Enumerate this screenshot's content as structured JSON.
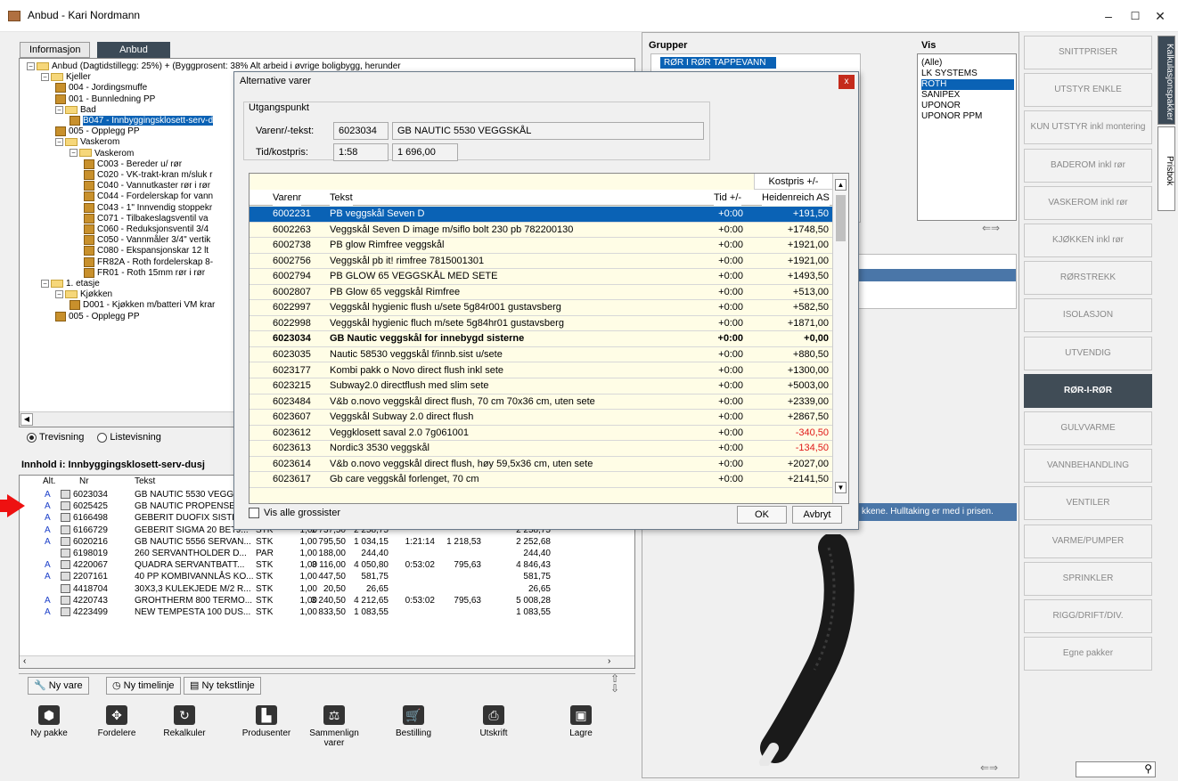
{
  "window": {
    "title": "Anbud - Kari Nordmann",
    "minimize": "–",
    "maximize": "☐",
    "close": "✕"
  },
  "tabs": [
    "Informasjon",
    "Anbud"
  ],
  "tree": [
    {
      "text": "Anbud (Dagtidstillegg: 25%) + (Byggprosent: 38%   Alt arbeid i øvrige boligbygg, herunder",
      "level": 0,
      "type": "folder"
    },
    {
      "text": "Kjeller",
      "level": 1,
      "type": "folder"
    },
    {
      "text": "004 - Jordingsmuffe",
      "level": 2,
      "type": "pkg"
    },
    {
      "text": "001 - Bunnledning PP",
      "level": 2,
      "type": "pkg"
    },
    {
      "text": "Bad",
      "level": 2,
      "type": "folder"
    },
    {
      "text": "B047 - Innbyggingsklosett-serv-d",
      "level": 3,
      "type": "pkg",
      "selected": true
    },
    {
      "text": "005 - Opplegg PP",
      "level": 2,
      "type": "pkg"
    },
    {
      "text": "Vaskerom",
      "level": 2,
      "type": "folder"
    },
    {
      "text": "Vaskerom",
      "level": 3,
      "type": "folder"
    },
    {
      "text": "C003 - Bereder u/ rør",
      "level": 4,
      "type": "pkg"
    },
    {
      "text": "C020 - VK-trakt-kran m/sluk r",
      "level": 4,
      "type": "pkg"
    },
    {
      "text": "C040 - Vannutkaster rør i rør",
      "level": 4,
      "type": "pkg"
    },
    {
      "text": "C044 - Fordelerskap for vann",
      "level": 4,
      "type": "pkg"
    },
    {
      "text": "C043 - 1\" Innvendig stoppekr",
      "level": 4,
      "type": "pkg"
    },
    {
      "text": "C071 - Tilbakeslagsventil va",
      "level": 4,
      "type": "pkg"
    },
    {
      "text": "C060 - Reduksjonsventil  3/4",
      "level": 4,
      "type": "pkg"
    },
    {
      "text": "C050 - Vannmåler 3/4\" vertik",
      "level": 4,
      "type": "pkg"
    },
    {
      "text": "C080 - Ekspansjonskar  12 lt",
      "level": 4,
      "type": "pkg"
    },
    {
      "text": "FR82A - Roth fordelerskap 8-",
      "level": 4,
      "type": "pkg"
    },
    {
      "text": "FR01 - Roth 15mm rør i rør",
      "level": 4,
      "type": "pkg"
    },
    {
      "text": "1. etasje",
      "level": 1,
      "type": "folder"
    },
    {
      "text": "Kjøkken",
      "level": 2,
      "type": "folder"
    },
    {
      "text": "D001 - Kjøkken m/batteri VM krar",
      "level": 3,
      "type": "pkg"
    },
    {
      "text": "005 - Opplegg PP",
      "level": 2,
      "type": "pkg"
    }
  ],
  "view": {
    "tree": "Trevisning",
    "list": "Listevisning"
  },
  "content_title": "Innhold i: Innbyggingsklosett-serv-dusj",
  "grid": {
    "headers": [
      "Alt.",
      "Nr",
      "Tekst"
    ],
    "rows": [
      [
        "A",
        "6023034",
        "GB NAUTIC 5530 VEGGS",
        "",
        "",
        "",
        "",
        "",
        "",
        ""
      ],
      [
        "A",
        "6025425",
        "GB NAUTIC PROPENSET",
        "",
        "",
        "",
        "",
        "",
        "",
        ""
      ],
      [
        "A",
        "6166498",
        "GEBERIT DUOFIX SISTE",
        "",
        "",
        "",
        "",
        "",
        "",
        ""
      ],
      [
        "A",
        "6166729",
        "GEBERIT SIGMA 20 BETJ...",
        "STK",
        "1,00",
        "1 737,50",
        "2 258,75",
        "",
        "",
        "2 258,75"
      ],
      [
        "A",
        "6020216",
        "GB NAUTIC 5556 SERVAN...",
        "STK",
        "1,00",
        "795,50",
        "1 034,15",
        "1:21:14",
        "1 218,53",
        "2 252,68"
      ],
      [
        "",
        "6198019",
        "260 SERVANTHOLDER D...",
        "PAR",
        "1,00",
        "188,00",
        "244,40",
        "",
        "",
        "244,40"
      ],
      [
        "A",
        "4220067",
        "QUADRA SERVANTBATT...",
        "STK",
        "1,00",
        "3 116,00",
        "4 050,80",
        "0:53:02",
        "795,63",
        "4 846,43"
      ],
      [
        "A",
        "2207161",
        "40 PP KOMBIVANNLÅS KO...",
        "STK",
        "1,00",
        "447,50",
        "581,75",
        "",
        "",
        "581,75"
      ],
      [
        "",
        "4418704",
        "30X3,3 KULEKJEDE M/2 R...",
        "STK",
        "1,00",
        "20,50",
        "26,65",
        "",
        "",
        "26,65"
      ],
      [
        "A",
        "4220743",
        "GROHTHERM 800 TERMO...",
        "STK",
        "1,00",
        "3 240,50",
        "4 212,65",
        "0:53:02",
        "795,63",
        "5 008,28"
      ],
      [
        "A",
        "4223499",
        "NEW TEMPESTA 100 DUS...",
        "STK",
        "1,00",
        "833,50",
        "1 083,55",
        "",
        "",
        "1 083,55"
      ]
    ]
  },
  "bottom_buttons": {
    "ny_vare": "Ny vare",
    "ny_timelinje": "Ny timelinje",
    "ny_tekstlinje": "Ny tekstlinje"
  },
  "toolbar": [
    {
      "label": "Ny pakke",
      "icon": "package-icon"
    },
    {
      "label": "Fordelere",
      "icon": "distributor-icon"
    },
    {
      "label": "Rekalkuler",
      "icon": "recalculate-icon"
    },
    {
      "label": "Produsenter",
      "icon": "factory-icon"
    },
    {
      "label": "Sammenlign varer",
      "icon": "scale-icon"
    },
    {
      "label": "Bestilling",
      "icon": "cart-icon"
    },
    {
      "label": "Utskrift",
      "icon": "printer-icon"
    },
    {
      "label": "Lagre",
      "icon": "save-icon"
    }
  ],
  "groups": {
    "label": "Grupper",
    "selected": "RØR I RØR TAPPEVANN"
  },
  "vis": {
    "label": "Vis",
    "items": [
      "(Alle)",
      "LK SYSTEMS",
      "ROTH",
      "SANIPEX",
      "UPONOR",
      "UPONOR PPM"
    ],
    "selected": "ROTH"
  },
  "categories": [
    "SNITTPRISER",
    "UTSTYR  ENKLE",
    "KUN UTSTYR inkl montering",
    "BADEROM inkl rør",
    "VASKEROM inkl rør",
    "KJØKKEN inkl rør",
    "RØRSTREKK",
    "ISOLASJON",
    "UTVENDIG",
    "RØR-I-RØR",
    "GULVVARME",
    "VANNBEHANDLING",
    "VENTILER",
    "VARME/PUMPER",
    "SPRINKLER",
    "RIGG/DRIFT/DIV.",
    "Egne pakker"
  ],
  "active_category": "RØR-I-RØR",
  "vertical_tabs": [
    "Kalkulasjonspakker",
    "Prisbok"
  ],
  "info_strip": "kkene. Hulltaking er med i prisen.",
  "dialog": {
    "title": "Alternative varer",
    "close": "x",
    "legend": "Utgangspunkt",
    "varenr_label": "Varenr/-tekst:",
    "varenr": "6023034",
    "vare_tekst": "GB NAUTIC 5530 VEGGSKÅL",
    "tid_label": "Tid/kostpris:",
    "tid": "1:58",
    "kostpris": "1 696,00",
    "col_group": "Kostpris +/-",
    "headers": [
      "Varenr",
      "Tekst",
      "Tid +/-",
      "Heidenreich AS"
    ],
    "rows": [
      {
        "nr": "6002231",
        "tekst": "PB veggskål Seven D",
        "tid": "+0:00",
        "pris": "+191,50",
        "selected": true
      },
      {
        "nr": "6002263",
        "tekst": "Veggskål Seven D image m/siflo bolt 230 pb 782200130",
        "tid": "+0:00",
        "pris": "+1748,50"
      },
      {
        "nr": "6002738",
        "tekst": "PB glow Rimfree veggskål",
        "tid": "+0:00",
        "pris": "+1921,00"
      },
      {
        "nr": "6002756",
        "tekst": "Veggskål pb it! rimfree 7815001301",
        "tid": "+0:00",
        "pris": "+1921,00"
      },
      {
        "nr": "6002794",
        "tekst": "PB GLOW 65 VEGGSKÅL MED SETE",
        "tid": "+0:00",
        "pris": "+1493,50"
      },
      {
        "nr": "6002807",
        "tekst": "PB Glow 65 veggskål Rimfree",
        "tid": "+0:00",
        "pris": "+513,00"
      },
      {
        "nr": "6022997",
        "tekst": "Veggskål hygienic flush u/sete 5g84r001 gustavsberg",
        "tid": "+0:00",
        "pris": "+582,50"
      },
      {
        "nr": "6022998",
        "tekst": "Veggskål hygienic fluch m/sete 5g84hr01 gustavsberg",
        "tid": "+0:00",
        "pris": "+1871,00"
      },
      {
        "nr": "6023034",
        "tekst": "GB Nautic veggskål for innebygd sisterne",
        "tid": "+0:00",
        "pris": "+0,00",
        "bold": true
      },
      {
        "nr": "6023035",
        "tekst": "Nautic 58530 veggskål f/innb.sist u/sete",
        "tid": "+0:00",
        "pris": "+880,50"
      },
      {
        "nr": "6023177",
        "tekst": "Kombi pakk o Novo direct flush inkl sete",
        "tid": "+0:00",
        "pris": "+1300,00"
      },
      {
        "nr": "6023215",
        "tekst": "Subway2.0 directflush med slim sete",
        "tid": "+0:00",
        "pris": "+5003,00"
      },
      {
        "nr": "6023484",
        "tekst": "V&b o.novo veggskål direct flush, 70 cm 70x36 cm, uten sete",
        "tid": "+0:00",
        "pris": "+2339,00"
      },
      {
        "nr": "6023607",
        "tekst": "Veggskål Subway 2.0 direct flush",
        "tid": "+0:00",
        "pris": "+2867,50"
      },
      {
        "nr": "6023612",
        "tekst": "Veggklosett saval 2.0 7g061001",
        "tid": "+0:00",
        "pris": "-340,50",
        "negative": true
      },
      {
        "nr": "6023613",
        "tekst": "Nordic3 3530 veggskål",
        "tid": "+0:00",
        "pris": "-134,50",
        "negative": true
      },
      {
        "nr": "6023614",
        "tekst": "V&b o.novo veggskål direct flush, høy 59,5x36 cm, uten sete",
        "tid": "+0:00",
        "pris": "+2027,00"
      },
      {
        "nr": "6023617",
        "tekst": "Gb care veggskål forlenget, 70 cm",
        "tid": "+0:00",
        "pris": "+2141,50"
      }
    ],
    "vis_alle": "Vis alle grossister",
    "ok": "OK",
    "avbryt": "Avbryt"
  }
}
